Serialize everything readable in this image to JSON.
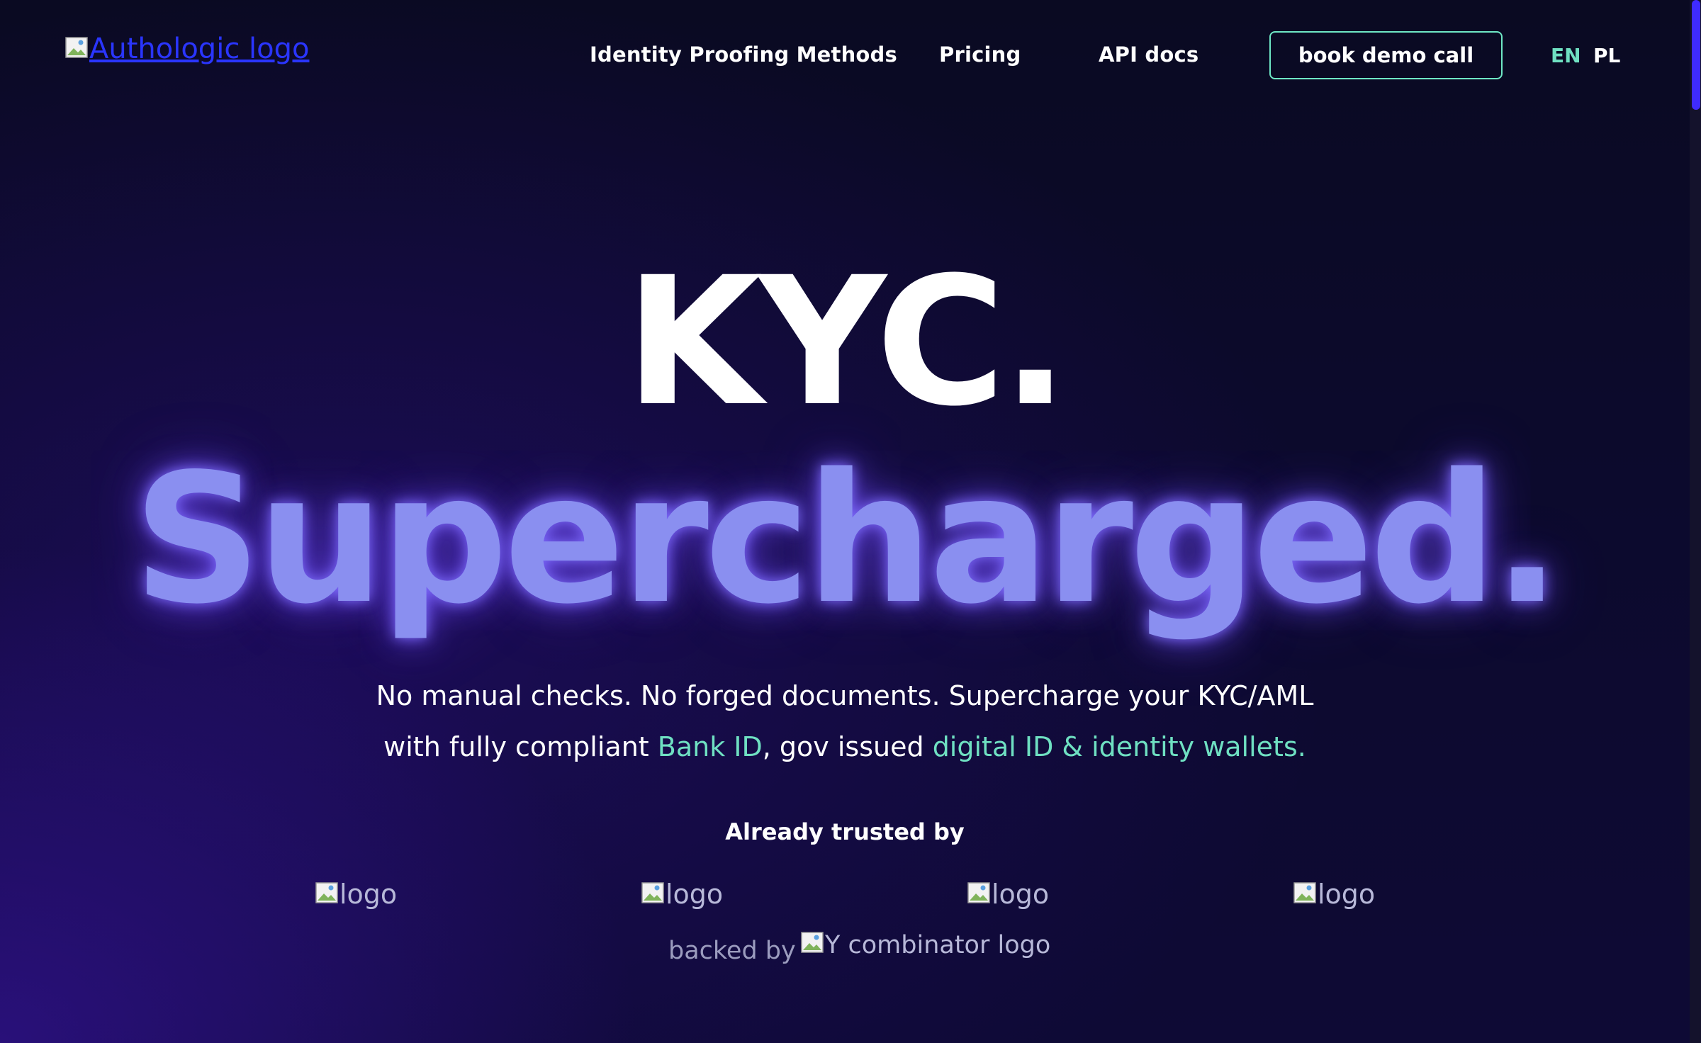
{
  "header": {
    "logo_alt": "Authologic logo",
    "nav": [
      {
        "label": "Identity Proofing Methods"
      },
      {
        "label": "Pricing"
      },
      {
        "label": "API docs"
      }
    ],
    "cta_label": "book demo call",
    "languages": [
      {
        "label": "EN",
        "active": true,
        "color": "#6fe0c2"
      },
      {
        "label": "PL",
        "active": false,
        "color": "#ffffff"
      }
    ]
  },
  "hero": {
    "title_line1": "KYC.",
    "title_line2": "Supercharged.",
    "subtitle_part1": "No manual checks. No forged documents. Supercharge your KYC/AML",
    "subtitle_part2": "with fully compliant ",
    "subtitle_link1": "Bank ID",
    "subtitle_part3": ", gov issued ",
    "subtitle_link2": "digital ID & identity wallets."
  },
  "trusted": {
    "heading": "Already trusted by",
    "logos": [
      {
        "alt": "logo"
      },
      {
        "alt": "logo"
      },
      {
        "alt": "logo"
      },
      {
        "alt": "logo"
      }
    ]
  },
  "backing": {
    "label": "backed by",
    "logo_alt": "Y combinator logo"
  },
  "colors": {
    "background": "#0b0a26",
    "accent_teal": "#6fe0c2",
    "headline_purple": "#8a8ff0",
    "link_blue": "#2a35ff",
    "scrollbar_thumb": "#3f2bff"
  }
}
